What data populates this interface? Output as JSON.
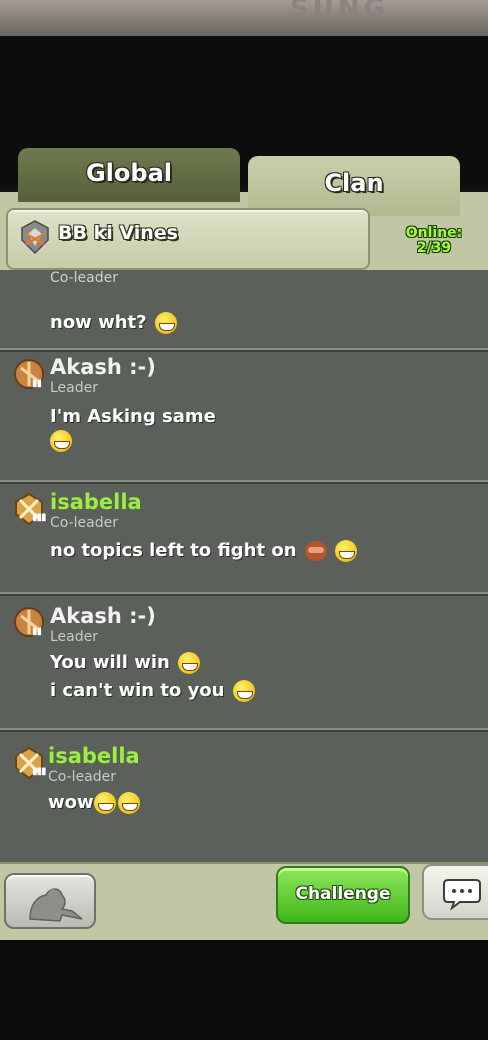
{
  "device": {
    "brand_text": "SUNG"
  },
  "tabs": [
    {
      "label": "Global",
      "active": false
    },
    {
      "label": "Clan",
      "active": true
    }
  ],
  "clan": {
    "name": "BB ki Vines",
    "online_label": "Online:",
    "online_count": "2/39"
  },
  "messages": [
    {
      "author": "",
      "role": "Co-leader",
      "lines": [
        "now wht?"
      ],
      "emojis": [
        "grin-emoji"
      ]
    },
    {
      "author": "Akash :-)",
      "role": "Leader",
      "lines": [
        "I'm Asking same",
        ""
      ],
      "emojis": [
        "grin-emoji"
      ]
    },
    {
      "author": "isabella",
      "role": "Co-leader",
      "lines": [
        "no topics left to fight on"
      ],
      "emojis": [
        "monkey-emoji",
        "grin-emoji"
      ]
    },
    {
      "author": "Akash :-)",
      "role": "Leader",
      "lines": [
        "You will win",
        "i can't win to you"
      ],
      "emojis": [
        "grin-emoji",
        "grin-emoji"
      ]
    },
    {
      "author": "isabella",
      "role": "Co-leader",
      "lines": [
        "wow"
      ],
      "emojis": [
        "grin-emoji",
        "grin-emoji"
      ]
    }
  ],
  "footer": {
    "challenge_label": "Challenge"
  },
  "colors": {
    "leader_name": "#f2f2f2",
    "coleader_name": "#9cef3e",
    "chat_bg": "#5c605b",
    "panel": "#c1c6a5"
  }
}
